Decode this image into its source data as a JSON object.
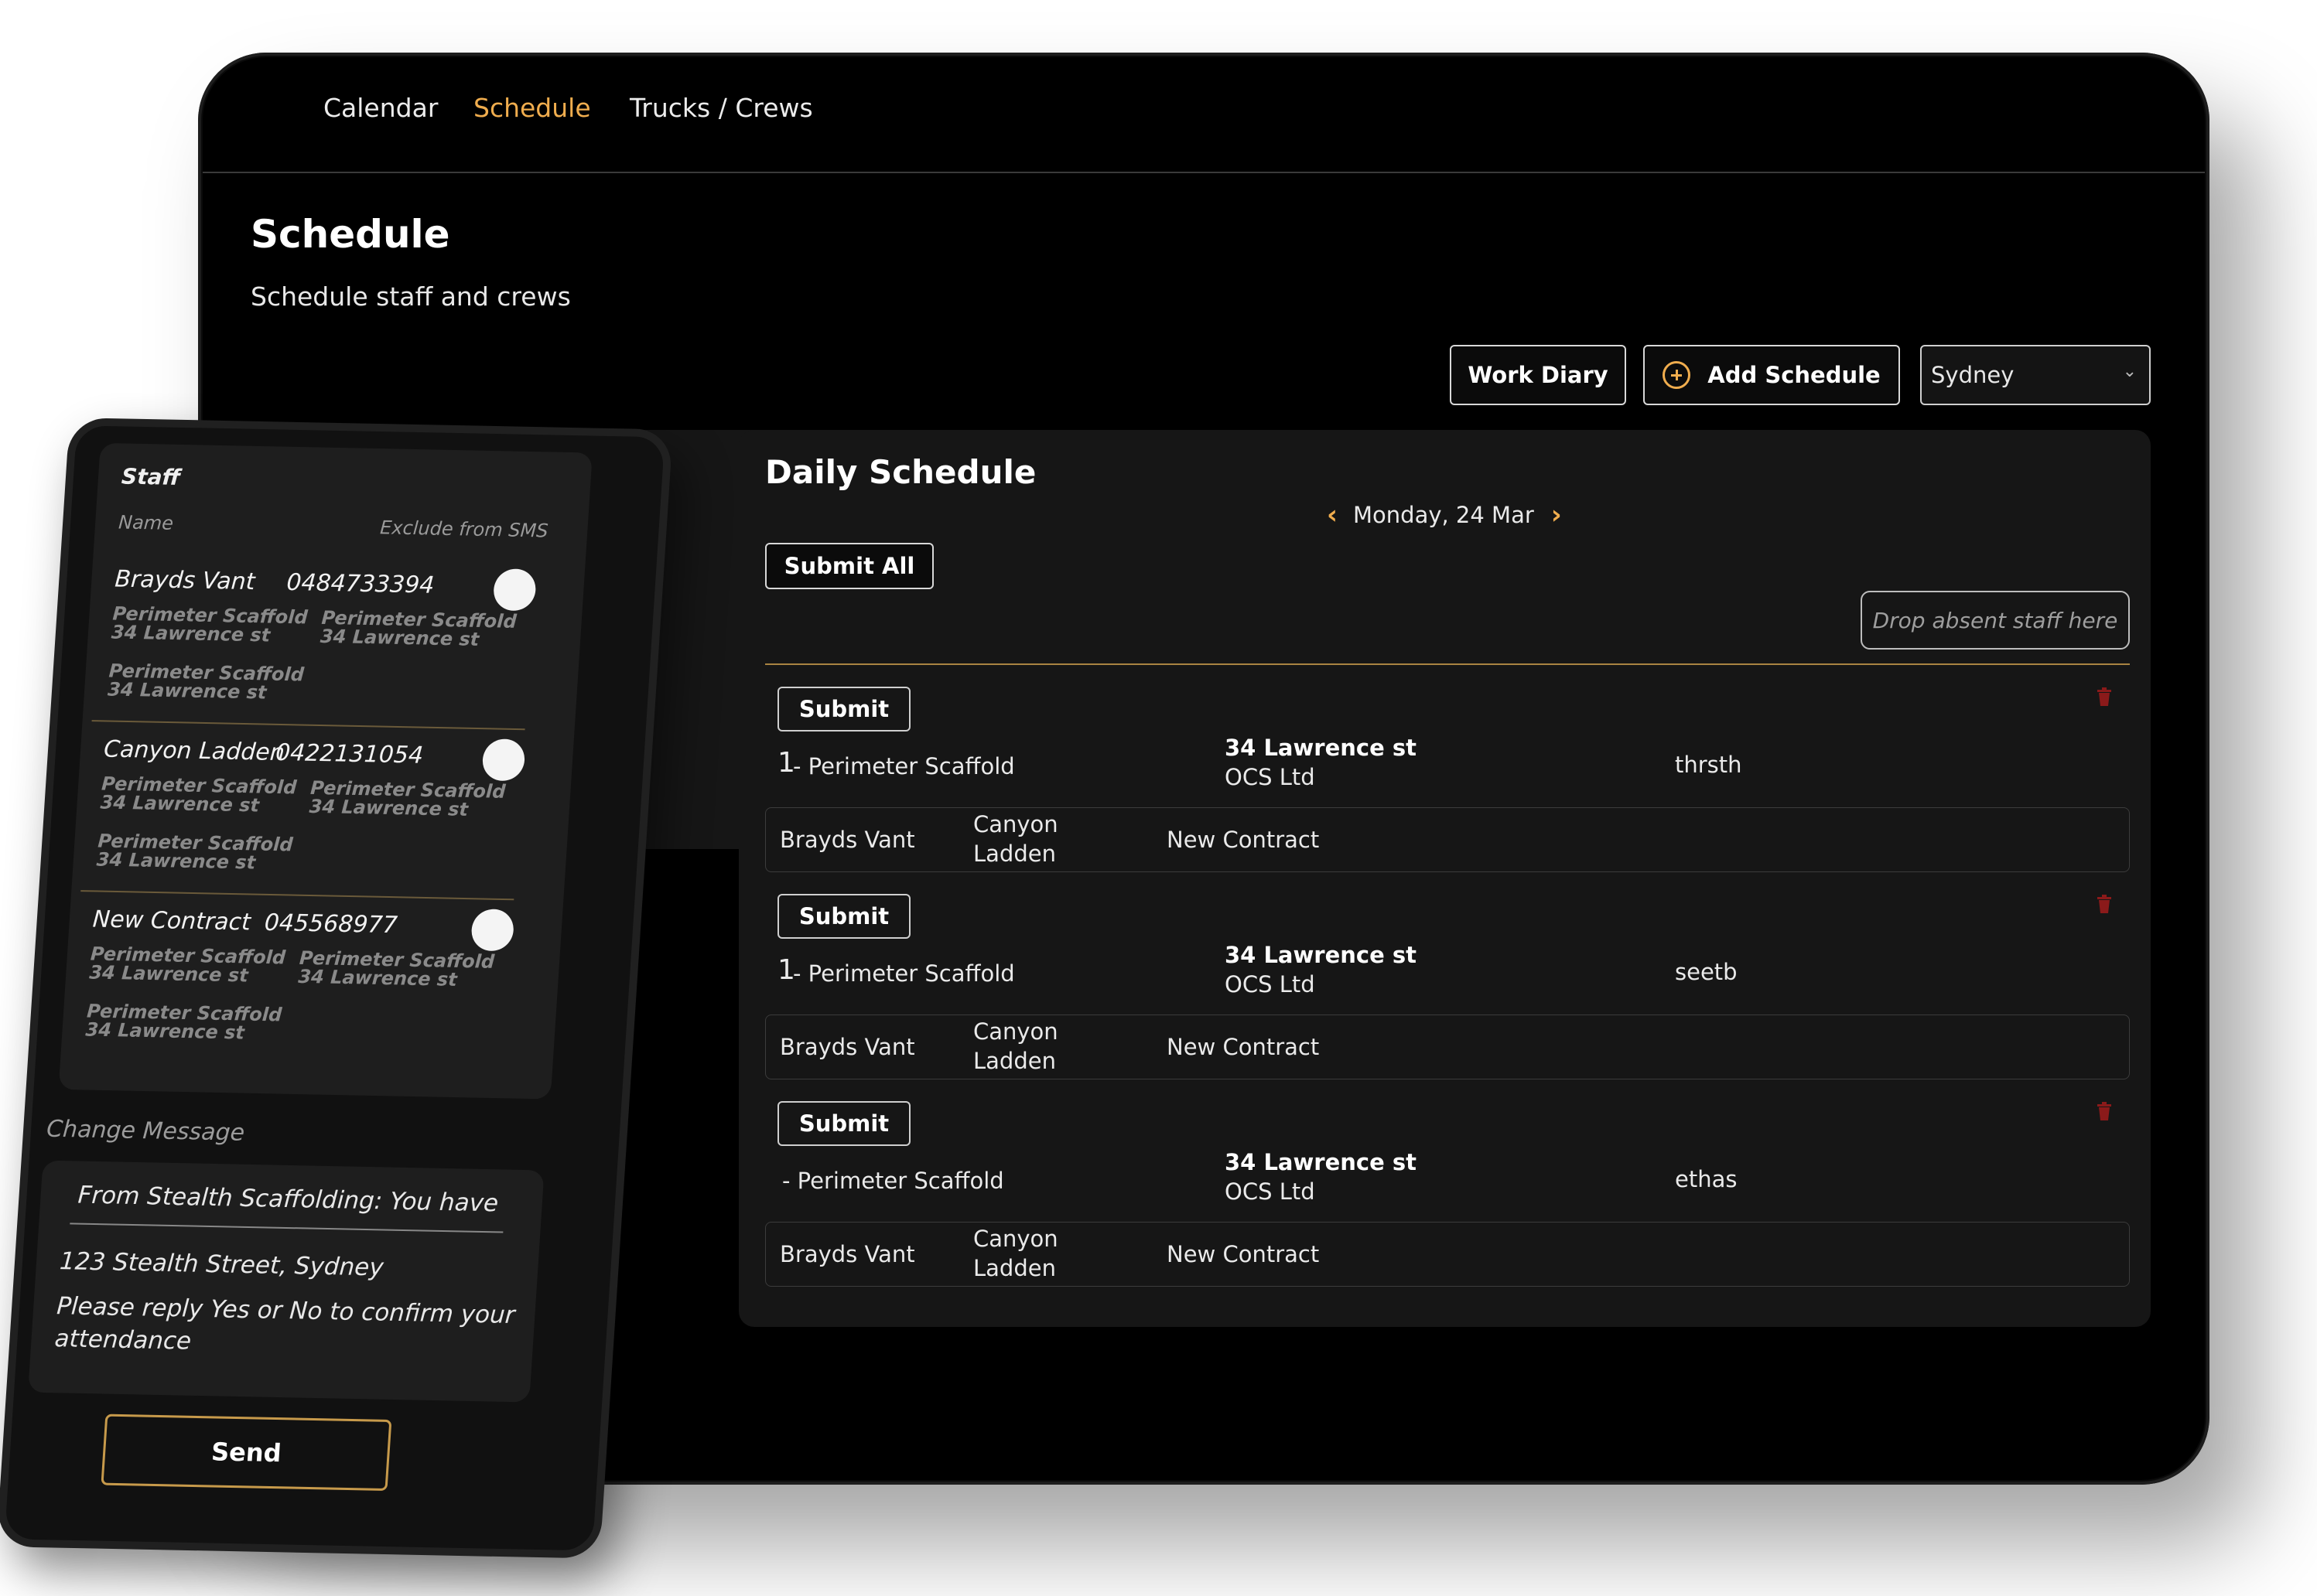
{
  "nav": {
    "items": [
      {
        "label": "Calendar",
        "active": false
      },
      {
        "label": "Schedule",
        "active": true
      },
      {
        "label": "Trucks / Crews",
        "active": false
      }
    ]
  },
  "page": {
    "title": "Schedule",
    "subtitle": "Schedule staff and crews"
  },
  "toolbar": {
    "work_diary_label": "Work Diary",
    "add_schedule_label": "Add Schedule",
    "location_select_value": "Sydney"
  },
  "daily": {
    "title": "Daily Schedule",
    "date": "Monday, 24 Mar",
    "submit_all_label": "Submit All",
    "drop_zone_placeholder": "Drop absent staff here",
    "schedules": [
      {
        "submit_label": "Submit",
        "index": "1",
        "site": "- Perimeter Scaffold",
        "address": "34 Lawrence st",
        "client": "OCS Ltd",
        "note": "thrsth",
        "crew": [
          "Brayds Vant",
          "Canyon Ladden",
          "New Contract"
        ]
      },
      {
        "submit_label": "Submit",
        "index": "1",
        "site": "- Perimeter Scaffold",
        "address": "34 Lawrence st",
        "client": "OCS Ltd",
        "note": "seetb",
        "crew": [
          "Brayds Vant",
          "Canyon Ladden",
          "New Contract"
        ]
      },
      {
        "submit_label": "Submit",
        "index": "",
        "site": "- Perimeter Scaffold",
        "address": "34 Lawrence st",
        "client": "OCS Ltd",
        "note": "ethas",
        "crew": [
          "Brayds Vant",
          "Canyon Ladden",
          "New Contract"
        ]
      }
    ]
  },
  "phone": {
    "staff_title": "Staff",
    "col_name": "Name",
    "col_exclude": "Exclude from SMS",
    "staff": [
      {
        "name": "Brayds Vant",
        "phone": "0484733394",
        "tag_site": "Perimeter Scaffold",
        "tag_addr": "34 Lawrence st"
      },
      {
        "name": "Canyon Ladden",
        "phone": "0422131054",
        "tag_site": "Perimeter Scaffold",
        "tag_addr": "34 Lawrence st"
      },
      {
        "name": "New Contract",
        "phone": "045568977",
        "tag_site": "Perimeter Scaffold",
        "tag_addr": "34 Lawrence st"
      }
    ],
    "change_message_label": "Change Message",
    "message_input_value": "From Stealth Scaffolding: You have b",
    "message_address": "123 Stealth Street, Sydney",
    "message_reply_1": "Please reply Yes or No to confirm your",
    "message_reply_2": "attendance",
    "send_label": "Send"
  },
  "colors": {
    "accent": "#f0ad4e",
    "background": "#000000",
    "panel": "#161616",
    "delete_icon": "#8b1a1a"
  },
  "icons": [
    "plus-circle-icon",
    "chevron-left-icon",
    "chevron-right-icon",
    "trash-icon",
    "chevron-down-icon"
  ]
}
